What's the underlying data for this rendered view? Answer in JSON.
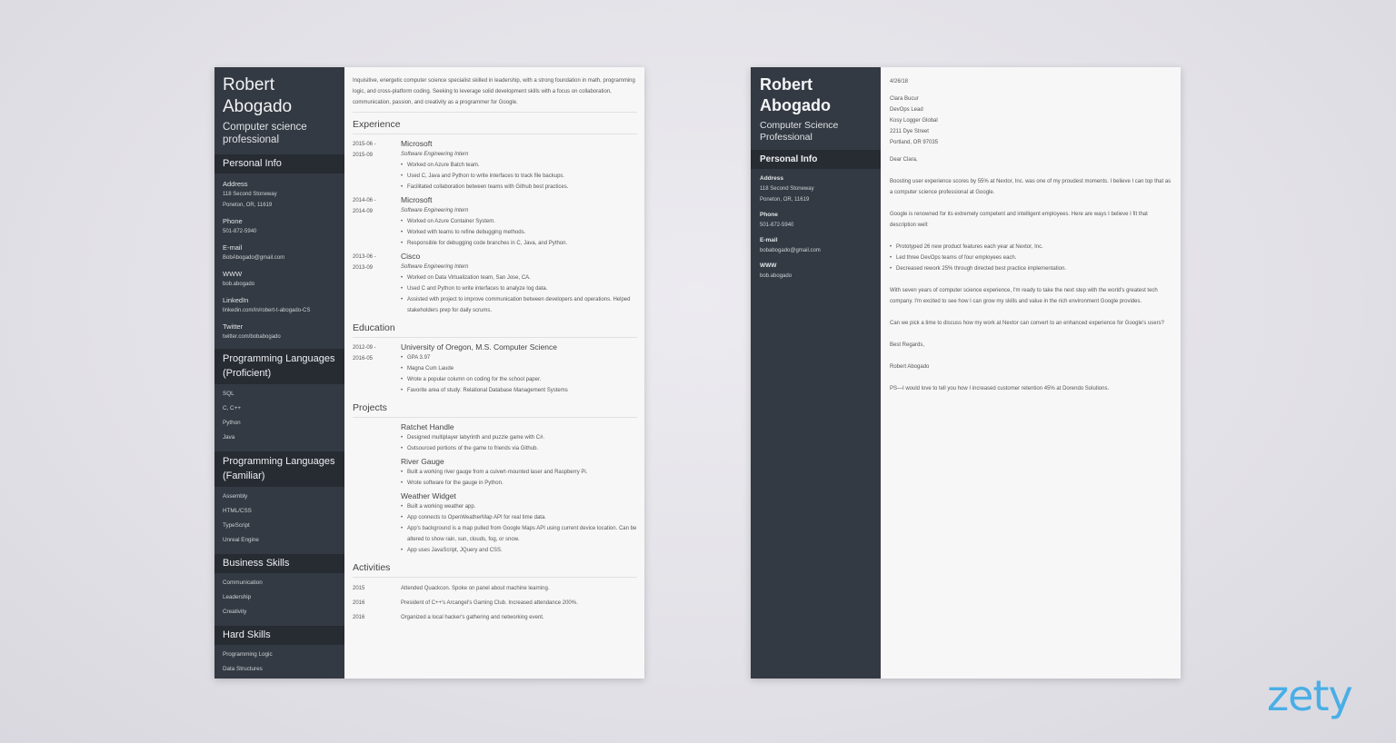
{
  "resume": {
    "name": "Robert Abogado",
    "title": "Computer science professional",
    "personal_info_heading": "Personal Info",
    "personal_info": [
      {
        "label": "Address",
        "values": [
          "118 Second Stoneway",
          "Poneton, OR, 11619"
        ]
      },
      {
        "label": "Phone",
        "values": [
          "501-872-5940"
        ]
      },
      {
        "label": "E-mail",
        "values": [
          "BobAbogado@gmail.com"
        ]
      },
      {
        "label": "WWW",
        "values": [
          "bob.abogado"
        ]
      },
      {
        "label": "LinkedIn",
        "values": [
          "linkedin.com/in/robert-t-abogado-CS"
        ]
      },
      {
        "label": "Twitter",
        "values": [
          "twitter.com/bobabogado"
        ]
      }
    ],
    "skill_groups": [
      {
        "heading": "Programming Languages (Proficient)",
        "items": [
          "SQL",
          "C, C++",
          "Python",
          "Java"
        ]
      },
      {
        "heading": "Programming Languages (Familiar)",
        "items": [
          "Assembly",
          "HTML/CSS",
          "TypeScript",
          "Unreal Engine"
        ]
      },
      {
        "heading": "Business Skills",
        "items": [
          "Communication",
          "Leadership",
          "Creativity"
        ]
      },
      {
        "heading": "Hard Skills",
        "items": [
          "Programming Logic",
          "Data Structures"
        ]
      }
    ],
    "summary": "Inquisitive, energetic computer science specialist skilled in leadership, with a strong foundation in math, programming logic, and cross-platform coding. Seeking to leverage solid development skills with a focus on collaboration, communication, passion, and creativity as a programmer for Google.",
    "experience_heading": "Experience",
    "experience": [
      {
        "date_start": "2015-06 -",
        "date_end": "2015-09",
        "company": "Microsoft",
        "role": "Software Engineering Intern",
        "bullets": [
          "Worked on Azure Batch team.",
          "Used C, Java and Python to write interfaces to track file backups.",
          "Facilitated collaboration between teams with Github best practices."
        ]
      },
      {
        "date_start": "2014-06 -",
        "date_end": "2014-09",
        "company": "Microsoft",
        "role": "Software Engineering Intern",
        "bullets": [
          "Worked on Azure Container System.",
          "Worked with teams to refine debugging methods.",
          "Responsible for debugging code branches in C, Java, and Python."
        ]
      },
      {
        "date_start": "2013-06 -",
        "date_end": "2013-09",
        "company": "Cisco",
        "role": "Software Engineering Intern",
        "bullets": [
          "Worked on Data Virtualization team, San Jose, CA.",
          "Used C and Python to write interfaces to analyze log data.",
          "Assisted with project to improve communication between developers and operations. Helped stakeholders prep for daily scrums."
        ]
      }
    ],
    "education_heading": "Education",
    "education": [
      {
        "date_start": "2012-09 -",
        "date_end": "2016-05",
        "school": "University of Oregon, M.S. Computer Science",
        "bullets": [
          "GPA 3.97",
          "Magna Cum Laude",
          "Wrote a popular column on coding for the school paper.",
          "Favorite area of study: Relational Database Management Systems"
        ]
      }
    ],
    "projects_heading": "Projects",
    "projects": [
      {
        "name": "Ratchet Handle",
        "bullets": [
          "Designed multiplayer labyrinth and puzzle game with C#.",
          "Outsourced portions of the game to friends via Github."
        ]
      },
      {
        "name": "River Gauge",
        "bullets": [
          "Built a working river gauge from a culvert-mounted laser and Raspberry Pi.",
          "Wrote software for the gauge in Python."
        ]
      },
      {
        "name": "Weather Widget",
        "bullets": [
          "Built a working weather app.",
          "App connects to OpenWeatherMap API for real time data.",
          "App's background is a map pulled from Google Maps API using current device location. Can be altered to show rain, sun, clouds, fog, or snow.",
          "App uses JavaScript, JQuery and CSS."
        ]
      }
    ],
    "activities_heading": "Activities",
    "activities": [
      {
        "year": "2015",
        "text": "Attended Quackcon. Spoke on panel about machine learning."
      },
      {
        "year": "2016",
        "text": "President of C++'s Arcangel's Gaming Club. Increased attendance 200%."
      },
      {
        "year": "2016",
        "text": "Organized a local hacker's gathering and networking event."
      }
    ]
  },
  "letter": {
    "name": "Robert Abogado",
    "title": "Computer Science Professional",
    "personal_info_heading": "Personal Info",
    "personal_info": [
      {
        "label": "Address",
        "values": [
          "118 Second Stoneway",
          "Poneton, OR, 11619"
        ]
      },
      {
        "label": "Phone",
        "values": [
          "501-872-5940"
        ]
      },
      {
        "label": "E-mail",
        "values": [
          "bobabogado@gmail.com"
        ]
      },
      {
        "label": "WWW",
        "values": [
          "bob.abogado"
        ]
      }
    ],
    "date": "4/26/18",
    "recipient": [
      "Clara Bucur",
      "DevOps Lead",
      "Kosy Logger Global",
      "2211 Dye Street",
      "Portland, OR 97035"
    ],
    "salutation": "Dear Clara,",
    "para1": "Boosting user experience scores by 55% at Nextor, Inc. was one of my proudest moments. I believe I can top that as a computer science professional at Google.",
    "para2": "Google is renowned for its extremely competent and intelligent employees. Here are ways I believe I fit that description well:",
    "bullets": [
      "Prototyped 26 new product features each year at Nextor, Inc.",
      "Led three DevOps teams of four employees each.",
      "Decreased rework 25% through directed best practice implementation."
    ],
    "para3": "With seven years of computer science experience, I'm ready to take the next step with the world's greatest tech company. I'm excited to see how I can grow my skills and value in the rich environment Google provides.",
    "para4": "Can we pick a time to discuss how my work at Nextor can convert to an enhanced experience for Google's users?",
    "closing": "Best Regards,",
    "signature": "Robert Abogado",
    "ps": "PS—I would love to tell you how I increased customer retention 45% at Dorendo Solutions."
  },
  "brand": {
    "logo_text": "zety",
    "color": "#4aaee6"
  }
}
